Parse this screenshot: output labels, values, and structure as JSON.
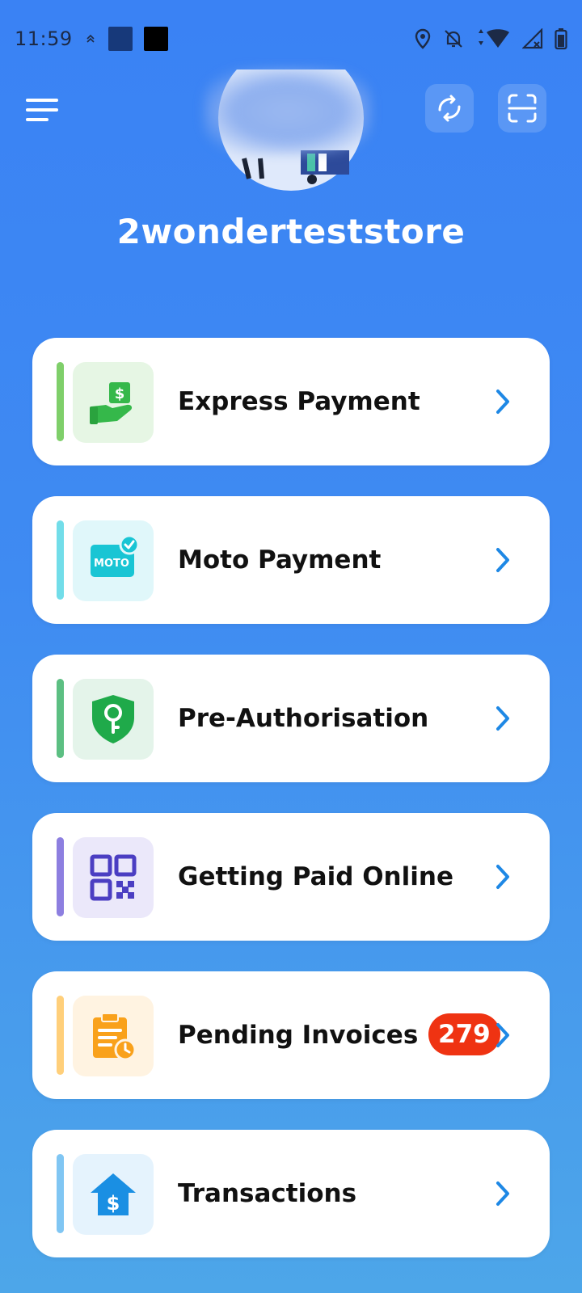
{
  "status_bar": {
    "time": "11:59",
    "colors": {
      "square_1": "#17397a",
      "square_2": "#000000"
    }
  },
  "header": {
    "menu_icon": "menu-icon",
    "sync_icon": "sync-icon",
    "scan_icon": "scan-icon"
  },
  "store": {
    "name": "2wonderteststore"
  },
  "menu_items": [
    {
      "label": "Express Payment",
      "icon": "hand-dollar-icon",
      "accent": "#7fcf6a",
      "icon_bg": "#e6f6e4"
    },
    {
      "label": "Moto Payment",
      "icon": "moto-card-icon",
      "accent": "#72dde9",
      "icon_bg": "#e0f7fa"
    },
    {
      "label": "Pre-Authorisation",
      "icon": "shield-key-icon",
      "accent": "#5cbf82",
      "icon_bg": "#e4f4ea"
    },
    {
      "label": "Getting Paid Online",
      "icon": "qr-code-icon",
      "accent": "#8d7fe0",
      "icon_bg": "#ebe8fa"
    },
    {
      "label": "Pending Invoices",
      "icon": "clipboard-clock-icon",
      "accent": "#ffcf7a",
      "icon_bg": "#fff3e1",
      "badge": "279"
    },
    {
      "label": "Transactions",
      "icon": "house-dollar-icon",
      "accent": "#80c6f3",
      "icon_bg": "#e5f3fd"
    }
  ],
  "colors": {
    "background": "#3a82f4",
    "chevron": "#1e88e5",
    "badge": "#ef3312"
  }
}
